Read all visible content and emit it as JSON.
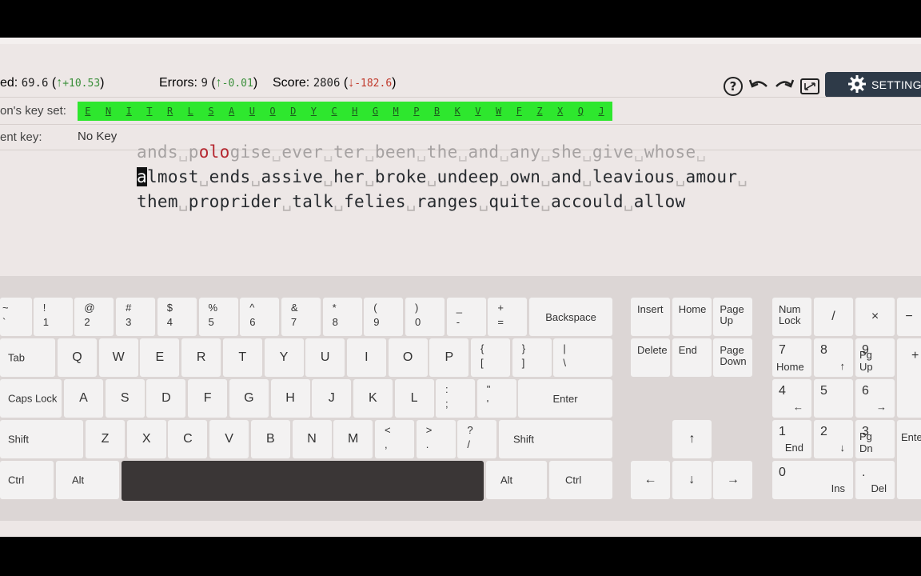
{
  "stats": {
    "speed": {
      "label": "ed:",
      "value": "69.6",
      "delta": "+10.53",
      "dir": "up"
    },
    "errors": {
      "label": "Errors:",
      "value": "9",
      "delta": "-0.01",
      "dir": "up"
    },
    "score": {
      "label": "Score:",
      "value": "2806",
      "delta": "-182.6",
      "dir": "down"
    }
  },
  "toolbar": {
    "help_icon": "question-icon",
    "undo_icon": "undo-icon",
    "redo_icon": "redo-icon",
    "fullscreen_icon": "fullscreen-icon",
    "settings_label": "SETTINGS"
  },
  "lesson": {
    "keyset_label": "on's key set:",
    "keys": [
      "E",
      "N",
      "I",
      "T",
      "R",
      "L",
      "S",
      "A",
      "U",
      "O",
      "D",
      "Y",
      "C",
      "H",
      "G",
      "M",
      "P",
      "B",
      "K",
      "V",
      "W",
      "F",
      "Z",
      "X",
      "Q",
      "J"
    ],
    "current_key_label": "ent key:",
    "current_key_value": "No Key"
  },
  "text": {
    "line1_pre": "ands␣p",
    "line1_err": "olo",
    "line1_post": "gise␣ever␣ter␣been␣the␣and␣any␣she␣give␣whose␣",
    "line2_cursor": "a",
    "line2_rest": "lmost␣ends␣assive␣her␣broke␣undeep␣own␣and␣leavious␣amour␣",
    "line3": "them␣proprider␣talk␣felies␣ranges␣quite␣accould␣allow"
  },
  "keyboard": {
    "row1": [
      [
        "~",
        "`"
      ],
      [
        "!",
        "1"
      ],
      [
        "@",
        "2"
      ],
      [
        "#",
        "3"
      ],
      [
        "$",
        "4"
      ],
      [
        "%",
        "5"
      ],
      [
        "^",
        "6"
      ],
      [
        "&",
        "7"
      ],
      [
        "*",
        "8"
      ],
      [
        "(",
        "9"
      ],
      [
        ")",
        "0"
      ],
      [
        "_",
        "-"
      ],
      [
        "+",
        "="
      ]
    ],
    "backspace": "Backspace",
    "tab": "Tab",
    "row2": [
      "Q",
      "W",
      "E",
      "R",
      "T",
      "Y",
      "U",
      "I",
      "O",
      "P"
    ],
    "row2_sym": [
      [
        "{",
        "["
      ],
      [
        "}",
        "]"
      ],
      [
        "|",
        "\\"
      ]
    ],
    "caps": "Caps Lock",
    "row3": [
      "A",
      "S",
      "D",
      "F",
      "G",
      "H",
      "J",
      "K",
      "L"
    ],
    "row3_sym": [
      [
        ":",
        ";"
      ],
      [
        "\"",
        "'"
      ]
    ],
    "enter": "Enter",
    "shift": "Shift",
    "row4": [
      "Z",
      "X",
      "C",
      "V",
      "B",
      "N",
      "M"
    ],
    "row4_sym": [
      [
        "<",
        ","
      ],
      [
        ">",
        "."
      ],
      [
        "?",
        "/"
      ]
    ],
    "ctrl": "Ctrl",
    "alt": "Alt",
    "nav": {
      "insert": "Insert",
      "home": "Home",
      "pageup": "Page\nUp",
      "delete": "Delete",
      "end": "End",
      "pagedown": "Page\nDown",
      "up": "↑",
      "left": "←",
      "down": "↓",
      "right": "→"
    },
    "numpad": {
      "numlock": "Num\nLock",
      "divide": "/",
      "multiply": "×",
      "minus": "−",
      "n7": [
        "7",
        "Home"
      ],
      "n8": [
        "8",
        "↑"
      ],
      "n9": [
        "9",
        "Pg Up"
      ],
      "plus": "+",
      "n4": [
        "4",
        "←"
      ],
      "n5": [
        "5",
        ""
      ],
      "n6": [
        "6",
        "→"
      ],
      "n1": [
        "1",
        "End"
      ],
      "n2": [
        "2",
        "↓"
      ],
      "n3": [
        "3",
        "Pg Dn"
      ],
      "enter": "Ente",
      "n0": [
        "0",
        "Ins"
      ],
      "dot": [
        ".",
        "Del"
      ]
    }
  }
}
